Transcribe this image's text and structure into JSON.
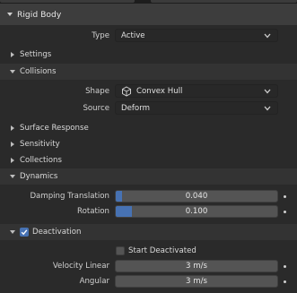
{
  "panel": {
    "title": "Rigid Body"
  },
  "type_field": {
    "label": "Type",
    "value": "Active"
  },
  "sections": {
    "settings": "Settings",
    "collisions": "Collisions",
    "surface_response": "Surface Response",
    "sensitivity": "Sensitivity",
    "collections": "Collections",
    "dynamics": "Dynamics",
    "deactivation": "Deactivation"
  },
  "collisions": {
    "shape_label": "Shape",
    "shape_value": "Convex Hull",
    "shape_icon": "convex-hull-icon",
    "source_label": "Source",
    "source_value": "Deform"
  },
  "dynamics": {
    "damping_translation_label": "Damping Translation",
    "damping_translation_value": "0.040",
    "damping_translation_fraction": 0.04,
    "rotation_label": "Rotation",
    "rotation_value": "0.100",
    "rotation_fraction": 0.1
  },
  "deactivation": {
    "enabled": true,
    "start_deactivated_label": "Start Deactivated",
    "start_deactivated_checked": false,
    "velocity_linear_label": "Velocity Linear",
    "velocity_linear_value": "3 m/s",
    "angular_label": "Angular",
    "angular_value": "3 m/s"
  },
  "colors": {
    "accent": "#4772b3",
    "background": "#2a2a2a",
    "header": "#3d3d3d",
    "field": "#545454"
  }
}
